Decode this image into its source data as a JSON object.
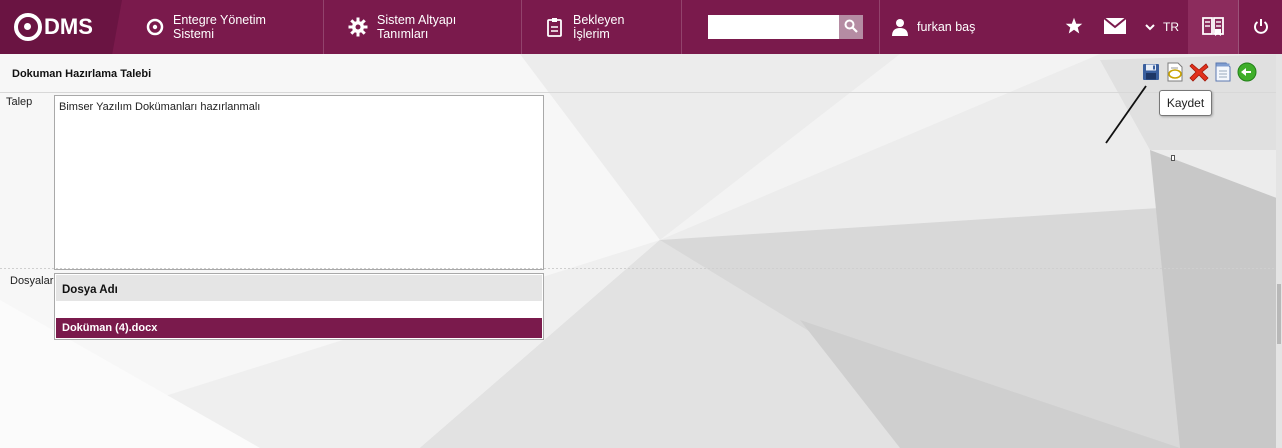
{
  "topbar": {
    "logo_text": "DMS",
    "nav": [
      {
        "label": "Entegre Yönetim Sistemi",
        "icon": "q-logo-icon"
      },
      {
        "label": "Sistem Altyapı Tanımları",
        "icon": "gear-icon"
      },
      {
        "label": "Bekleyen İşlerim",
        "icon": "clipboard-icon"
      }
    ],
    "search": {
      "value": "",
      "placeholder": "",
      "icon": "search-icon"
    },
    "user": {
      "name": "furkan baş",
      "icon": "user-icon"
    },
    "icons": [
      "star-icon",
      "mail-icon",
      "chevron-down-icon",
      "book-icon",
      "power-icon"
    ],
    "language": "TR",
    "colors": {
      "bar": "#7a1a4c",
      "logo_bg": "#6a1442",
      "search_btn": "#b58ca3"
    }
  },
  "page": {
    "title": "Dokuman Hazırlama Talebi",
    "toolbar": {
      "buttons": [
        "save-icon",
        "edit-document-icon",
        "delete-icon",
        "document-icon",
        "back-arrow-icon"
      ],
      "tooltip": "Kaydet"
    },
    "form": {
      "talep_label": "Talep",
      "talep_value": "Bimser Yazılım Dokümanları hazırlanmalı",
      "dosyalar_label": "Dosyalar",
      "files_grid": {
        "column_header": "Dosya Adı",
        "rows": [
          "Doküman (4).docx"
        ]
      }
    }
  }
}
